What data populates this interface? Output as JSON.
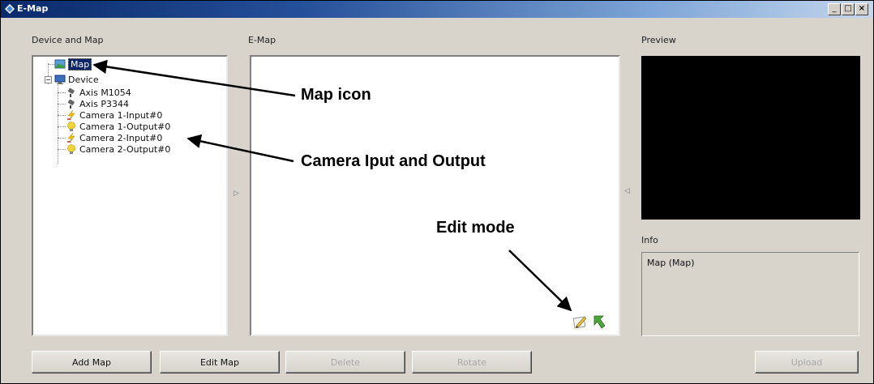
{
  "window": {
    "title": "E-Map",
    "buttons": [
      "_",
      "□",
      "×"
    ]
  },
  "sections": {
    "device_and_map": "Device and Map",
    "emap": "E-Map",
    "preview": "Preview",
    "info": "Info"
  },
  "tree": {
    "items": [
      {
        "label": "Map",
        "icon": "map-icon",
        "selected": true
      },
      {
        "label": "Device",
        "icon": "monitor-icon"
      },
      {
        "label": "Axis M1054",
        "icon": "camera-icon"
      },
      {
        "label": "Axis P3344",
        "icon": "camera-icon"
      },
      {
        "label": "Camera 1-Input#0",
        "icon": "input-bolt-icon"
      },
      {
        "label": "Camera 1-Output#0",
        "icon": "output-bulb-icon"
      },
      {
        "label": "Camera 2-Input#0",
        "icon": "input-bolt-icon"
      },
      {
        "label": "Camera 2-Output#0",
        "icon": "output-bulb-icon"
      }
    ]
  },
  "info": {
    "text": "Map (Map)"
  },
  "buttons": {
    "add_map": "Add Map",
    "edit_map": "Edit Map",
    "delete": "Delete",
    "rotate": "Rotate",
    "upload": "Upload"
  },
  "annotations": {
    "map_icon": "Map icon",
    "camera_io": "Camera Iput and Output",
    "edit_mode": "Edit mode"
  },
  "colors": {
    "selection": "#0a246a",
    "window_bg": "#d8d4cc",
    "preview_bg": "#000000"
  }
}
